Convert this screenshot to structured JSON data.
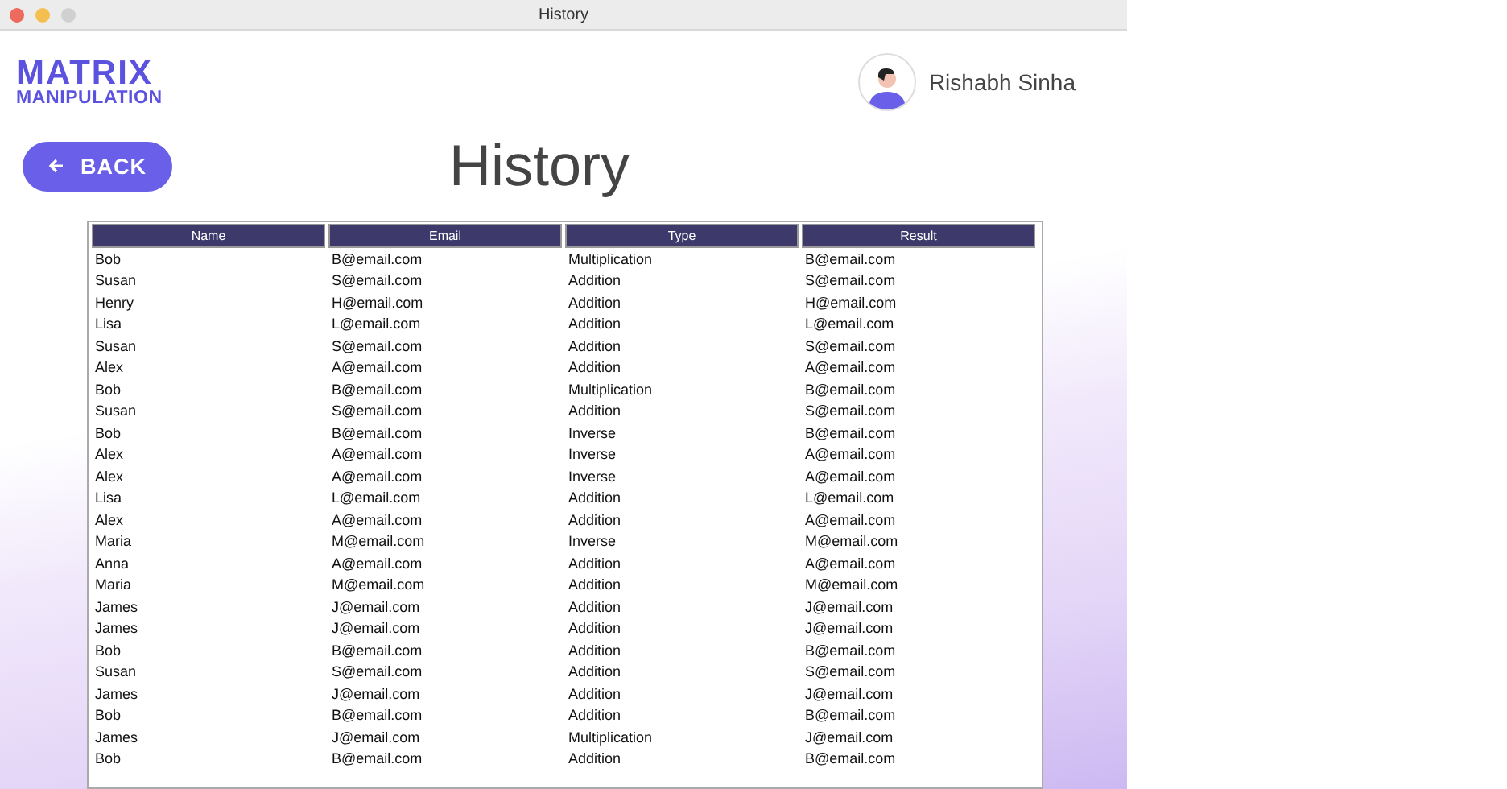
{
  "window": {
    "title": "History"
  },
  "logo": {
    "line_1": "MATRIX",
    "line_2": "MANIPULATION"
  },
  "user": {
    "name": "Rishabh Sinha"
  },
  "back_button": {
    "label": "BACK"
  },
  "heading": "History",
  "table": {
    "columns": [
      "Name",
      "Email",
      "Type",
      "Result"
    ],
    "rows": [
      [
        "Bob",
        "B@email.com",
        "Multiplication",
        "B@email.com"
      ],
      [
        "Susan",
        "S@email.com",
        "Addition",
        "S@email.com"
      ],
      [
        "Henry",
        "H@email.com",
        "Addition",
        "H@email.com"
      ],
      [
        "Lisa",
        "L@email.com",
        "Addition",
        "L@email.com"
      ],
      [
        "Susan",
        "S@email.com",
        "Addition",
        "S@email.com"
      ],
      [
        "Alex",
        "A@email.com",
        "Addition",
        "A@email.com"
      ],
      [
        "Bob",
        "B@email.com",
        "Multiplication",
        "B@email.com"
      ],
      [
        "Susan",
        "S@email.com",
        "Addition",
        "S@email.com"
      ],
      [
        "Bob",
        "B@email.com",
        "Inverse",
        "B@email.com"
      ],
      [
        "Alex",
        "A@email.com",
        "Inverse",
        "A@email.com"
      ],
      [
        "Alex",
        "A@email.com",
        "Inverse",
        "A@email.com"
      ],
      [
        "Lisa",
        "L@email.com",
        "Addition",
        "L@email.com"
      ],
      [
        "Alex",
        "A@email.com",
        "Addition",
        "A@email.com"
      ],
      [
        "Maria",
        "M@email.com",
        "Inverse",
        "M@email.com"
      ],
      [
        "Anna",
        "A@email.com",
        "Addition",
        "A@email.com"
      ],
      [
        "Maria",
        "M@email.com",
        "Addition",
        "M@email.com"
      ],
      [
        "James",
        "J@email.com",
        "Addition",
        "J@email.com"
      ],
      [
        "James",
        "J@email.com",
        "Addition",
        "J@email.com"
      ],
      [
        "Bob",
        "B@email.com",
        "Addition",
        "B@email.com"
      ],
      [
        "Susan",
        "S@email.com",
        "Addition",
        "S@email.com"
      ],
      [
        "James",
        "J@email.com",
        "Addition",
        "J@email.com"
      ],
      [
        "Bob",
        "B@email.com",
        "Addition",
        "B@email.com"
      ],
      [
        "James",
        "J@email.com",
        "Multiplication",
        "J@email.com"
      ],
      [
        "Bob",
        "B@email.com",
        "Addition",
        "B@email.com"
      ]
    ]
  }
}
